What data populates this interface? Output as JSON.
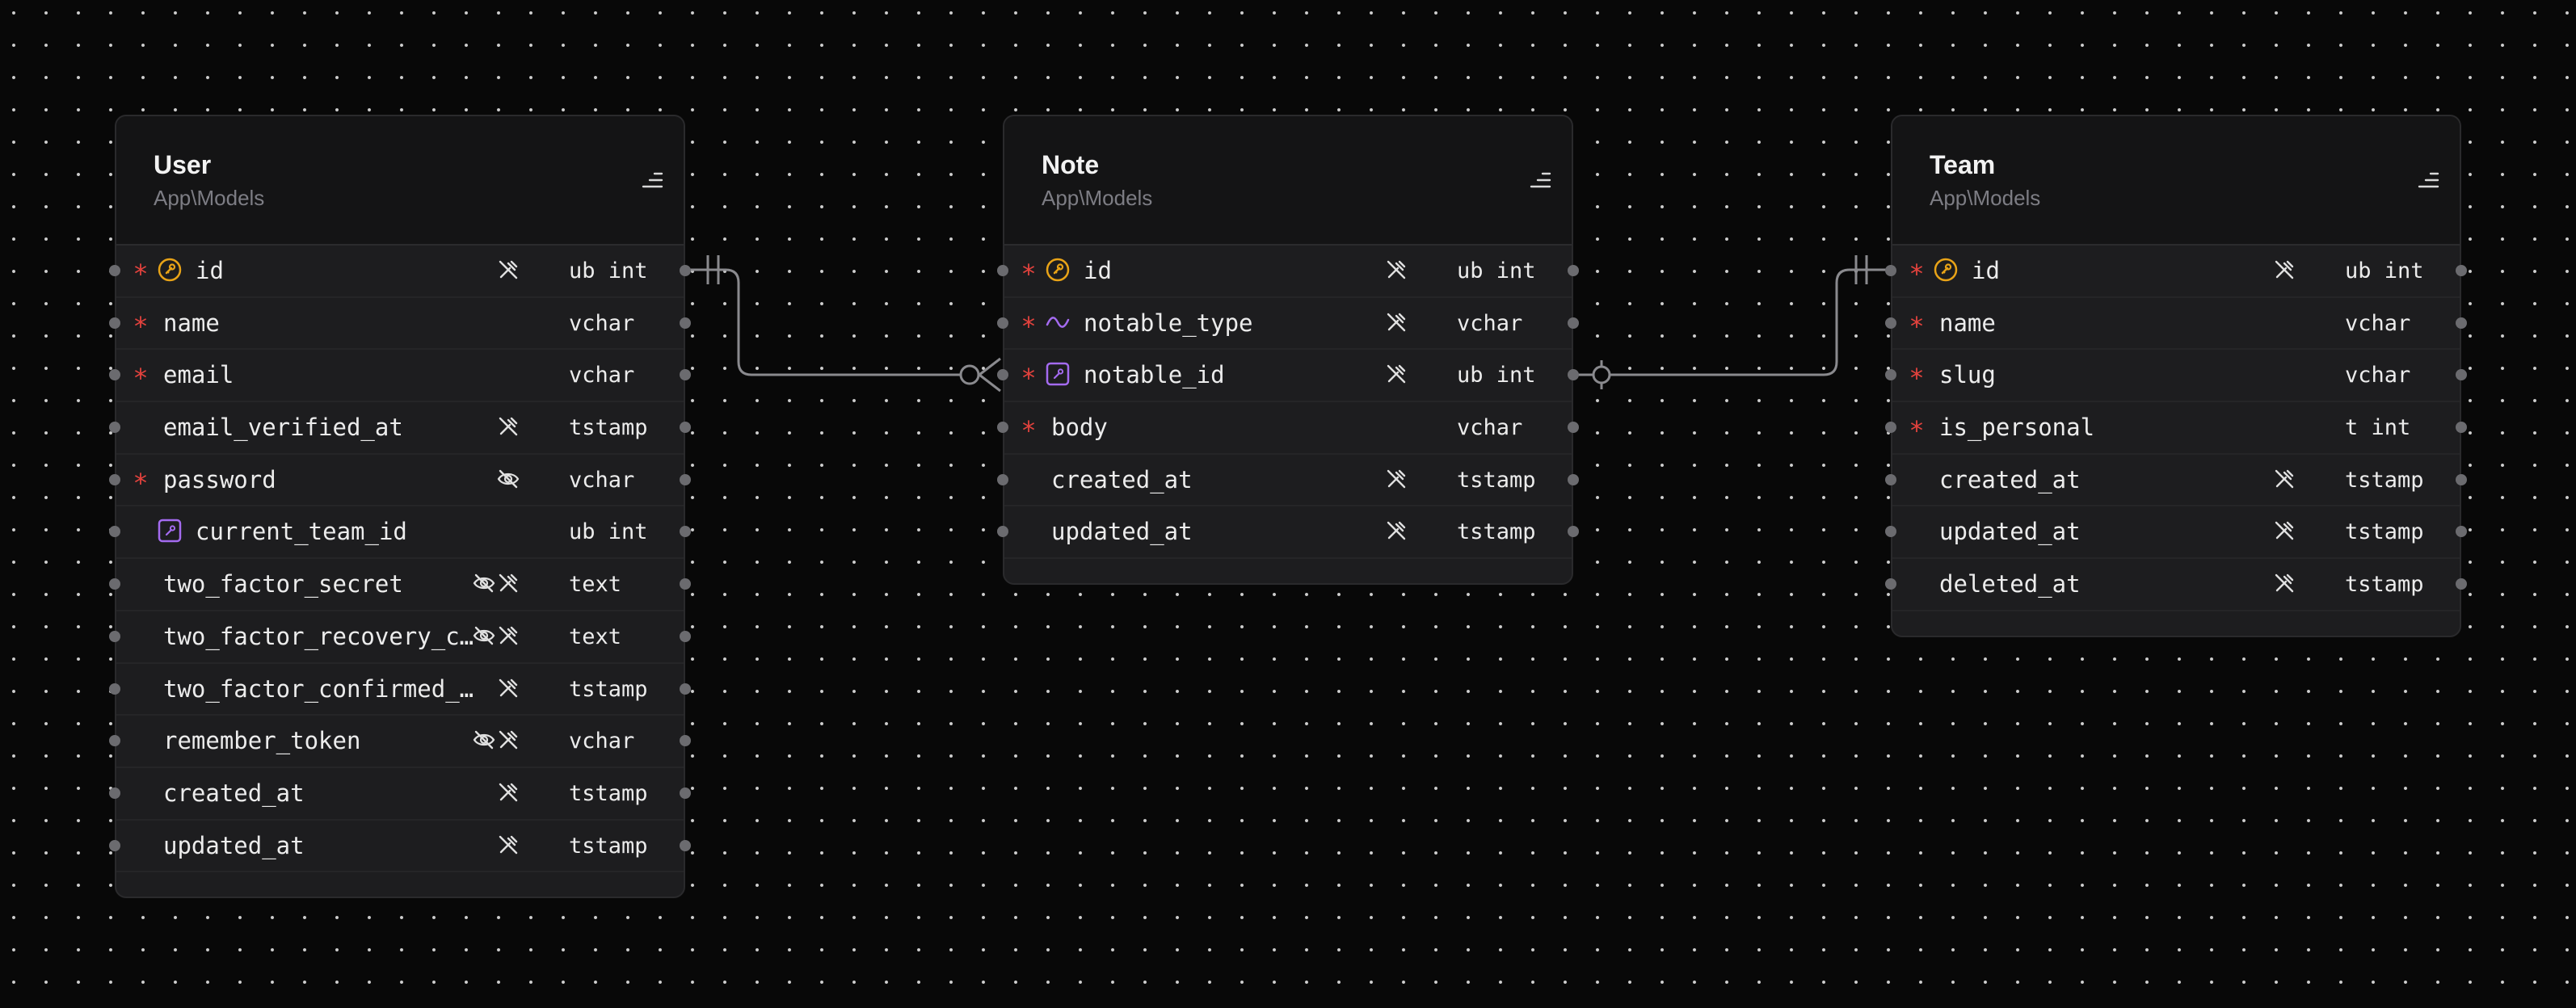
{
  "tables": [
    {
      "name": "User",
      "namespace": "App\\Models",
      "fields": [
        {
          "name": "id",
          "type": "ub int",
          "required": true,
          "key": "primary",
          "flags": [
            "unfillable-icon"
          ]
        },
        {
          "name": "name",
          "type": "vchar",
          "required": true,
          "key": "",
          "flags": []
        },
        {
          "name": "email",
          "type": "vchar",
          "required": true,
          "key": "",
          "flags": []
        },
        {
          "name": "email_verified_at",
          "type": "tstamp",
          "required": false,
          "key": "",
          "flags": [
            "unfillable-icon"
          ]
        },
        {
          "name": "password",
          "type": "vchar",
          "required": true,
          "key": "",
          "flags": [
            "hidden-icon"
          ]
        },
        {
          "name": "current_team_id",
          "type": "ub int",
          "required": false,
          "key": "foreign",
          "flags": []
        },
        {
          "name": "two_factor_secret",
          "type": "text",
          "required": false,
          "key": "",
          "flags": [
            "hidden-icon",
            "unfillable-icon"
          ]
        },
        {
          "name": "two_factor_recovery_cod…",
          "type": "text",
          "required": false,
          "key": "",
          "flags": [
            "hidden-icon",
            "unfillable-icon"
          ]
        },
        {
          "name": "two_factor_confirmed_at",
          "type": "tstamp",
          "required": false,
          "key": "",
          "flags": [
            "unfillable-icon"
          ]
        },
        {
          "name": "remember_token",
          "type": "vchar",
          "required": false,
          "key": "",
          "flags": [
            "hidden-icon",
            "unfillable-icon"
          ]
        },
        {
          "name": "created_at",
          "type": "tstamp",
          "required": false,
          "key": "",
          "flags": [
            "unfillable-icon"
          ]
        },
        {
          "name": "updated_at",
          "type": "tstamp",
          "required": false,
          "key": "",
          "flags": [
            "unfillable-icon"
          ]
        }
      ]
    },
    {
      "name": "Note",
      "namespace": "App\\Models",
      "fields": [
        {
          "name": "id",
          "type": "ub int",
          "required": true,
          "key": "primary",
          "flags": [
            "unfillable-icon"
          ]
        },
        {
          "name": "notable_type",
          "type": "vchar",
          "required": true,
          "key": "morph",
          "flags": [
            "unfillable-icon"
          ]
        },
        {
          "name": "notable_id",
          "type": "ub int",
          "required": true,
          "key": "foreign",
          "flags": [
            "unfillable-icon"
          ]
        },
        {
          "name": "body",
          "type": "vchar",
          "required": true,
          "key": "",
          "flags": []
        },
        {
          "name": "created_at",
          "type": "tstamp",
          "required": false,
          "key": "",
          "flags": [
            "unfillable-icon"
          ]
        },
        {
          "name": "updated_at",
          "type": "tstamp",
          "required": false,
          "key": "",
          "flags": [
            "unfillable-icon"
          ]
        }
      ]
    },
    {
      "name": "Team",
      "namespace": "App\\Models",
      "fields": [
        {
          "name": "id",
          "type": "ub int",
          "required": true,
          "key": "primary",
          "flags": [
            "unfillable-icon"
          ]
        },
        {
          "name": "name",
          "type": "vchar",
          "required": true,
          "key": "",
          "flags": []
        },
        {
          "name": "slug",
          "type": "vchar",
          "required": true,
          "key": "",
          "flags": []
        },
        {
          "name": "is_personal",
          "type": "t int",
          "required": true,
          "key": "",
          "flags": []
        },
        {
          "name": "created_at",
          "type": "tstamp",
          "required": false,
          "key": "",
          "flags": [
            "unfillable-icon"
          ]
        },
        {
          "name": "updated_at",
          "type": "tstamp",
          "required": false,
          "key": "",
          "flags": [
            "unfillable-icon"
          ]
        },
        {
          "name": "deleted_at",
          "type": "tstamp",
          "required": false,
          "key": "",
          "flags": [
            "unfillable-icon"
          ]
        }
      ]
    }
  ],
  "relations": [
    {
      "from_table": "User",
      "from_field": "id",
      "to_table": "Note",
      "to_field": "notable_id",
      "from_cardinality": "one-and-only-one",
      "to_cardinality": "zero-or-many"
    },
    {
      "from_table": "Note",
      "from_field": "notable_id",
      "to_table": "Team",
      "to_field": "id",
      "from_cardinality": "zero-or-one",
      "to_cardinality": "one-and-only-one"
    }
  ],
  "colors": {
    "background": "#080808",
    "required": "#e3423d",
    "primary_key": "#e8a317",
    "foreign_key": "#a46bf0",
    "connector": "#8a8a8e"
  }
}
